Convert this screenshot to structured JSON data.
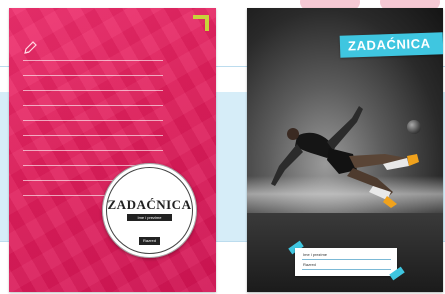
{
  "notebook_pink": {
    "title": "ZADAĆNICA",
    "subtitle": "Ime i prezime",
    "class_label": "Razred",
    "colors": {
      "cover": "#e01f5c",
      "corner": "#c8d23a",
      "badge": "#ffffff"
    }
  },
  "notebook_football": {
    "title": "ZADAĆNICA",
    "name_label": "Ime i prezime",
    "class_label": "Razred",
    "colors": {
      "tape": "#3fc6e0",
      "photo": "#5c5c5c"
    }
  }
}
